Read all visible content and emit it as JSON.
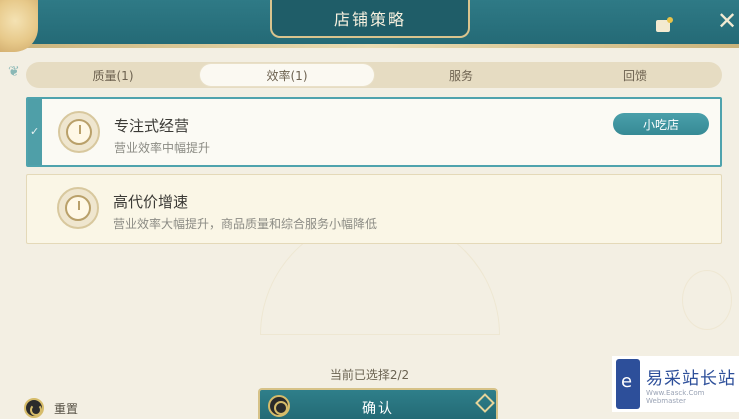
{
  "header": {
    "title": "店铺策略"
  },
  "tabs": [
    {
      "label": "质量(1)",
      "active": false
    },
    {
      "label": "效率(1)",
      "active": true
    },
    {
      "label": "服务",
      "active": false
    },
    {
      "label": "回馈",
      "active": false
    }
  ],
  "cards": [
    {
      "title": "专注式经营",
      "subtitle": "营业效率中幅提升",
      "tag": "小吃店",
      "selected": true
    },
    {
      "title": "高代价增速",
      "subtitle": "营业效率大幅提升，商品质量和综合服务小幅降低",
      "selected": false
    }
  ],
  "footer": {
    "selection_count": "当前已选择2/2",
    "reset_label": "重置",
    "confirm_label": "确认"
  },
  "watermark": {
    "main": "易采站长站",
    "small": "Www.Easck.Com Webmaster"
  },
  "colors": {
    "teal": "#2f7a86",
    "gold": "#d6c288",
    "cream": "#f3efe3"
  }
}
